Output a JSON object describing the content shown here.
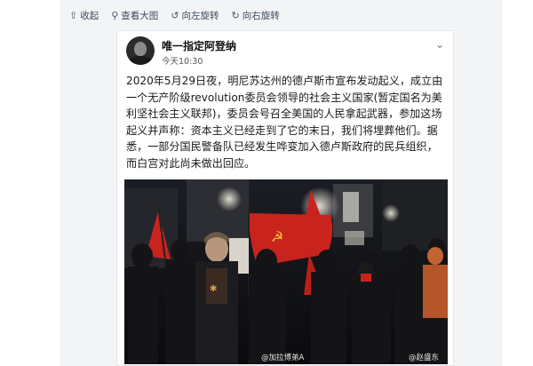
{
  "toolbar": {
    "collapse": {
      "icon": "collapse-icon",
      "label": "收起"
    },
    "view_large": {
      "icon": "magnifier-icon",
      "label": "查看大图"
    },
    "rotate_left": {
      "icon": "rotate-left-icon",
      "label": "向左旋转"
    },
    "rotate_right": {
      "icon": "rotate-right-icon",
      "label": "向右旋转"
    }
  },
  "post": {
    "username": "唯一指定阿登纳",
    "timestamp": "今天10:30",
    "text": "2020年5月29日夜，明尼苏达州的德卢斯市宣布发动起义，成立由一个无产阶级revolution委员会领导的社会主义国家(暂定国名为美利坚社会主义联邦)，委员会号召全美国的人民拿起武器，参加这场起义并声称：资本主义已经走到了它的末日，我们将埋葬他们。据悉，一部分国民警备队已经发生哗变加入德卢斯政府的民兵组织，而白宫对此尚未做出回应。",
    "image": {
      "watermark_left": "@加拉博弟A",
      "watermark_right": "@赵盛东"
    }
  },
  "colors": {
    "flag_red": "#c8241d",
    "viewer_bg": "#f3f4f6",
    "toolbar_text": "#3d4a5c"
  }
}
